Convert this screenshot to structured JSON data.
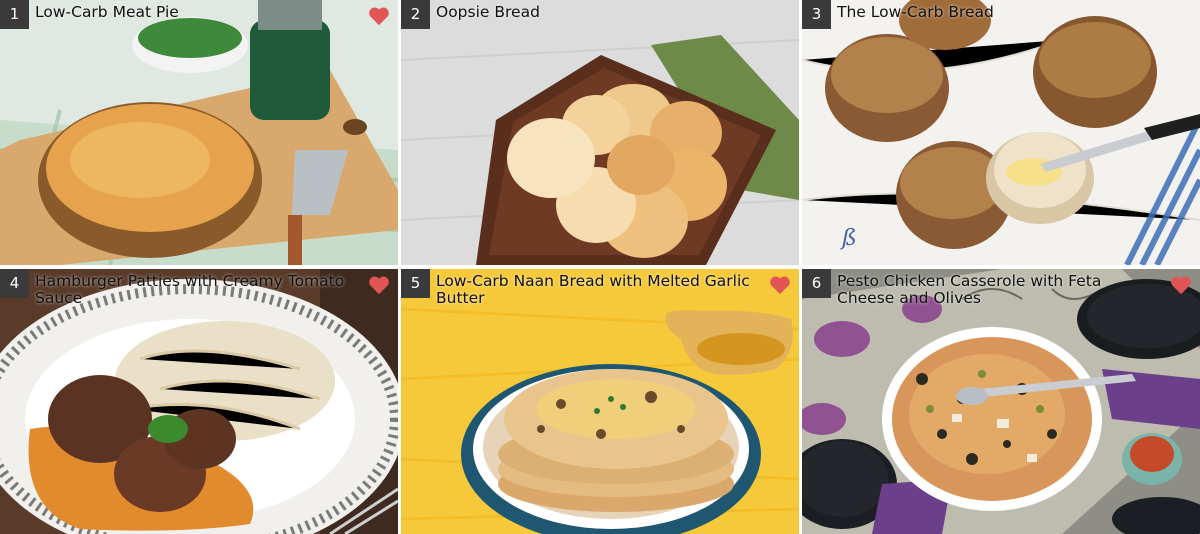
{
  "recipes": [
    {
      "number": "1",
      "title": "Low-Carb Meat Pie",
      "favorited": true
    },
    {
      "number": "2",
      "title": "Oopsie Bread",
      "favorited": false
    },
    {
      "number": "3",
      "title": "The Low-Carb Bread",
      "favorited": false
    },
    {
      "number": "4",
      "title": "Hamburger Patties with Creamy Tomato Sauce",
      "favorited": true
    },
    {
      "number": "5",
      "title": "Low-Carb Naan Bread with Melted Garlic Butter",
      "favorited": true
    },
    {
      "number": "6",
      "title": "Pesto Chicken Casserole with Feta Cheese and Olives",
      "favorited": true
    }
  ],
  "colors": {
    "heart": "#e25555",
    "number_badge": "#3a3a3a"
  },
  "icons": {
    "favorite": "heart-icon"
  }
}
